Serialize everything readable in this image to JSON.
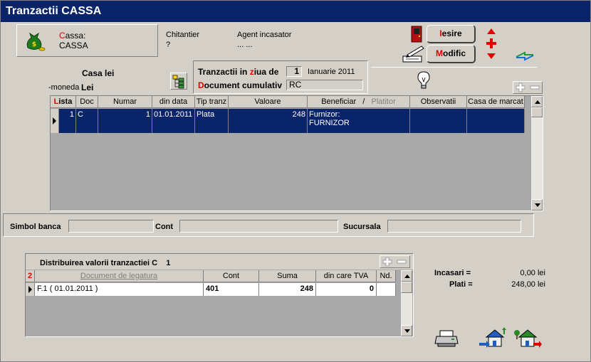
{
  "window": {
    "title": "Tranzactii CASSA"
  },
  "cassa": {
    "label_first": "C",
    "label_rest": "assa:",
    "value": "CASSA"
  },
  "chitantier": {
    "label": "Chitantier",
    "value": "?"
  },
  "agent": {
    "label": "Agent incasator",
    "value": "...  ..."
  },
  "buttons": {
    "iesire_first": "I",
    "iesire_rest": "esire",
    "modific_first": "M",
    "modific_rest": "odific"
  },
  "casa": {
    "title": "Casa lei",
    "moneda_label": "-moneda",
    "moneda_value": "Lei"
  },
  "filter": {
    "zi_label_a": "Tranzactii in ",
    "zi_label_z": "z",
    "zi_label_b": "iua de",
    "zi_value": "1",
    "zi_month": "Ianuarie 2011",
    "doc_label_a": "D",
    "doc_label_b": "ocument cumulativ",
    "doc_value": "RC"
  },
  "grid": {
    "headers": {
      "lista_first": "L",
      "lista_rest": "ista",
      "doc": "Doc",
      "numar": "Numar",
      "din_data": "din data",
      "tip": "Tip tranz",
      "valoare": "Valoare",
      "beneficiar": "Beneficiar",
      "slash": "/",
      "platitor": "Platitor",
      "observatii": "Observatii",
      "casa_marcat": "Casa de marcat"
    },
    "row": {
      "lista": "1",
      "doc": "C",
      "numar": "1",
      "din_data": "01.01.2011",
      "tip": "Plata",
      "valoare": "248",
      "beneficiar_line1": "Furnizor:",
      "beneficiar_line2": "FURNIZOR",
      "observatii": "",
      "casa_marcat": ""
    }
  },
  "bank": {
    "simbol_label": "Simbol banca",
    "simbol_value": "",
    "cont_label": "Cont",
    "cont_value": "",
    "sucursala_label": "Sucursala",
    "sucursala_value": ""
  },
  "distrib": {
    "title": "Distribuirea valorii tranzactiei C",
    "title_num": "1",
    "headers": {
      "num": "2",
      "document": "Document de legatura",
      "cont": "Cont",
      "suma": "Suma",
      "tva": "din care TVA",
      "nd": "Nd."
    },
    "row": {
      "document": "F.1 ( 01.01.2011 )",
      "cont": "401",
      "suma": "248",
      "tva": "0",
      "nd": ""
    }
  },
  "totals": {
    "incasari_label": "Incasari =",
    "incasari_value": "0,00 lei",
    "plati_label": "Plati =",
    "plati_value": "248,00 lei"
  },
  "colors": {
    "title_bg": "#0a246a",
    "selection": "#0a246a",
    "accent_red": "#e00000"
  }
}
